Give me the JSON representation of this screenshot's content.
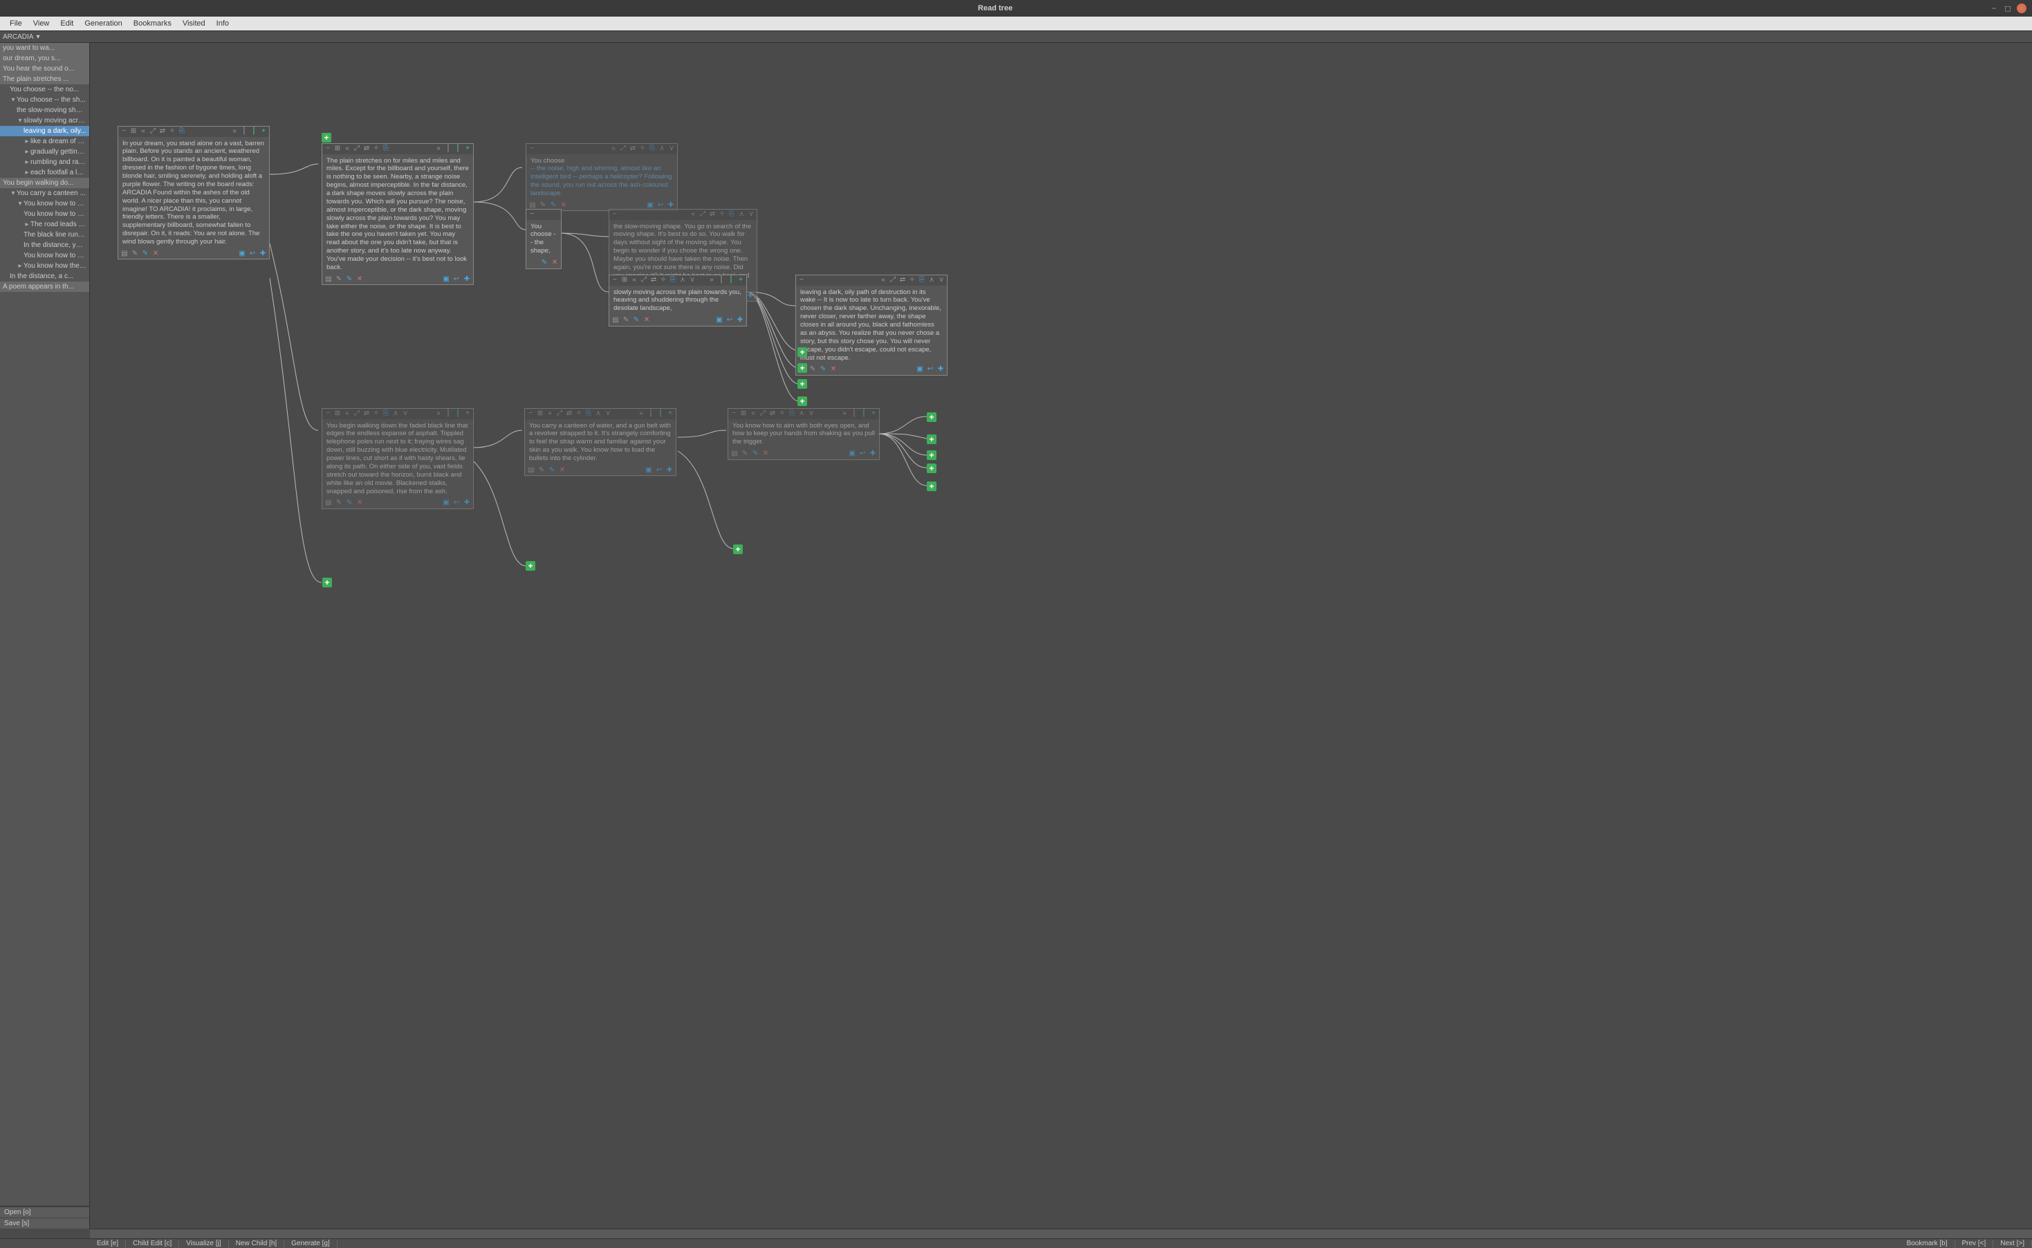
{
  "window": {
    "title": "Read tree"
  },
  "menu": [
    "File",
    "View",
    "Edit",
    "Generation",
    "Bookmarks",
    "Visited",
    "Info"
  ],
  "subtitle": "ARCADIA",
  "sidebar": {
    "items": [
      {
        "t": "you want to wa...",
        "l": 0,
        "sel": false
      },
      {
        "t": "our dream, you s...",
        "l": 0,
        "sel": false
      },
      {
        "t": "You hear the sound o...",
        "l": 0,
        "sel": false
      },
      {
        "t": "The plain stretches ...",
        "l": 0,
        "sel": false
      },
      {
        "t": "You choose -- the no...",
        "l": 1,
        "sel": false
      },
      {
        "t": "You choose -- the sh...",
        "l": 1,
        "sel": false,
        "chev": "▾"
      },
      {
        "t": "the slow-moving shap...",
        "l": 2,
        "sel": false
      },
      {
        "t": "slowly moving across...",
        "l": 2,
        "sel": false,
        "chev": "▾"
      },
      {
        "t": "leaving a dark, oily...",
        "l": 3,
        "sel": true
      },
      {
        "t": "like a dream of moti...",
        "l": 3,
        "sel": false,
        "chev": "▸"
      },
      {
        "t": "gradually getting la...",
        "l": 3,
        "sel": false,
        "chev": "▸"
      },
      {
        "t": "rumbling and rattlin...",
        "l": 3,
        "sel": false,
        "chev": "▸"
      },
      {
        "t": "each footfall a lead...",
        "l": 3,
        "sel": false,
        "chev": "▸"
      },
      {
        "t": "You begin walking do...",
        "l": 0,
        "sel": false
      },
      {
        "t": "You carry a canteen ...",
        "l": 1,
        "sel": false,
        "chev": "▾"
      },
      {
        "t": "You know how to aim ...",
        "l": 2,
        "sel": false,
        "chev": "▾"
      },
      {
        "t": "You know how to shoo...",
        "l": 3,
        "sel": false
      },
      {
        "t": "The road leads past ...",
        "l": 3,
        "sel": false,
        "chev": "▸"
      },
      {
        "t": "The black line runs ...",
        "l": 3,
        "sel": false
      },
      {
        "t": "In the distance, you...",
        "l": 3,
        "sel": false
      },
      {
        "t": "You know how to brea...",
        "l": 3,
        "sel": false
      },
      {
        "t": "You know how the tri...",
        "l": 2,
        "sel": false,
        "chev": "▸"
      },
      {
        "t": "In the distance, a c...",
        "l": 1,
        "sel": false
      },
      {
        "t": "A poem appears in th...",
        "l": 0,
        "sel": false
      }
    ],
    "open": "Open [o]",
    "save": "Save [s]"
  },
  "nodes": {
    "n1": "In your dream, you stand alone on a vast, barren plain. Before you stands an ancient, weathered billboard. On it is painted a beautiful woman, dressed in the fashion of bygone times, long blonde hair, smiling serenely, and holding aloft a purple flower. The writing on the board reads: ARCADIA Found within the ashes of the old world. A nicer place than this, you cannot imagine! TO ARCADIA! it proclaims, in large, friendly letters. There is a smaller, supplementary billboard, somewhat fallen to disrepair. On it, it reads: You are not alone.\nThe wind blows gently through your hair.",
    "n2": "The plain stretches on for miles and miles and miles. Except for the billboard and yourself, there is nothing to be seen.\nNearby, a strange noise begins, almost imperceptible.\nIn the far distance, a dark shape moves slowly across the plain towards you.\nWhich will you pursue?\nThe noise, almost imperceptible, or the dark shape, moving slowly across the plain towards you?\nYou may take either the noise, or the shape.\nIt is best to take the one you haven't taken yet.\nYou may read about the one you didn't take, but that is another story, and it's too late now anyway. You've made your decision -- it's best not to look back.",
    "n3_a": "You choose",
    "n3_b": "-- the noise, high and whirring, almost like an intelligent bird -- perhaps a helicopter? Following the sound, you run out across the ash-coloured landscape.",
    "n4": "You choose -- the shape,",
    "n5": " the slow-moving shape. You go in search of the moving shape.\nIt's best to do so.\nYou walk for days without sight of the moving shape.\nYou begin to wonder if you chose the wrong one.\nMaybe you should have taken the noise. Then again, you're not sure there is any noise. Did you imagine it?\nIt might be best to go back and check.",
    "n6": "slowly moving across the plain towards you, heaving and shuddering through the desolate landscape,",
    "n7": " leaving a dark, oily path of destruction in its wake --\nIt is now too late to turn back.\nYou've chosen the dark shape.\nUnchanging, inexorable, never closer, never farther away, the shape closes in all around you, black and fathomless as an abyss. You realize that you never chose a story, but this story chose you. You will never escape, you didn't escape, could not escape, must not escape.",
    "n8": "You begin walking down the faded black line that edges the endless expanse of asphalt. Toppled telephone poles run next to it; fraying wires sag down, still buzzing with blue electricity. Mutilated power lines, cut short as if with hasty shears, lie along its path. On either side of you, vast fields stretch out toward the horizon, burnt black and white like an old movie. Blackened stalks, snapped and poisoned, rise from the ash.",
    "n9": " You carry a canteen of water, and a gun belt with a revolver strapped to it. It's strangely comforting to feel the strap warm and familiar against your skin as you walk. You know how to load the bullets into the cylinder.",
    "n10": "You know how to aim with both eyes open, and how to keep your hands from shaking as you pull the trigger."
  },
  "status": {
    "left": [
      "Edit [e]",
      "Child Edit [c]",
      "Visualize [j]",
      "New Child [h]",
      "Generate [g]"
    ],
    "right": [
      "Bookmark [b]",
      "Prev [<]",
      "Next [>]"
    ]
  },
  "icons": {
    "minus": "−",
    "grid": "⊞",
    "dleft": "«",
    "expand": "⤢",
    "link": "⇄",
    "share": "✧",
    "copy": "⎘",
    "dright": "»",
    "bar": "⎮",
    "barg": "⎮",
    "plus": "+",
    "up": "⋏",
    "down": "⋎",
    "book": "▤",
    "chart": "✎",
    "pencil": "✎",
    "x": "✕",
    "save": "▣",
    "back": "↩",
    "bplus": "✚"
  }
}
